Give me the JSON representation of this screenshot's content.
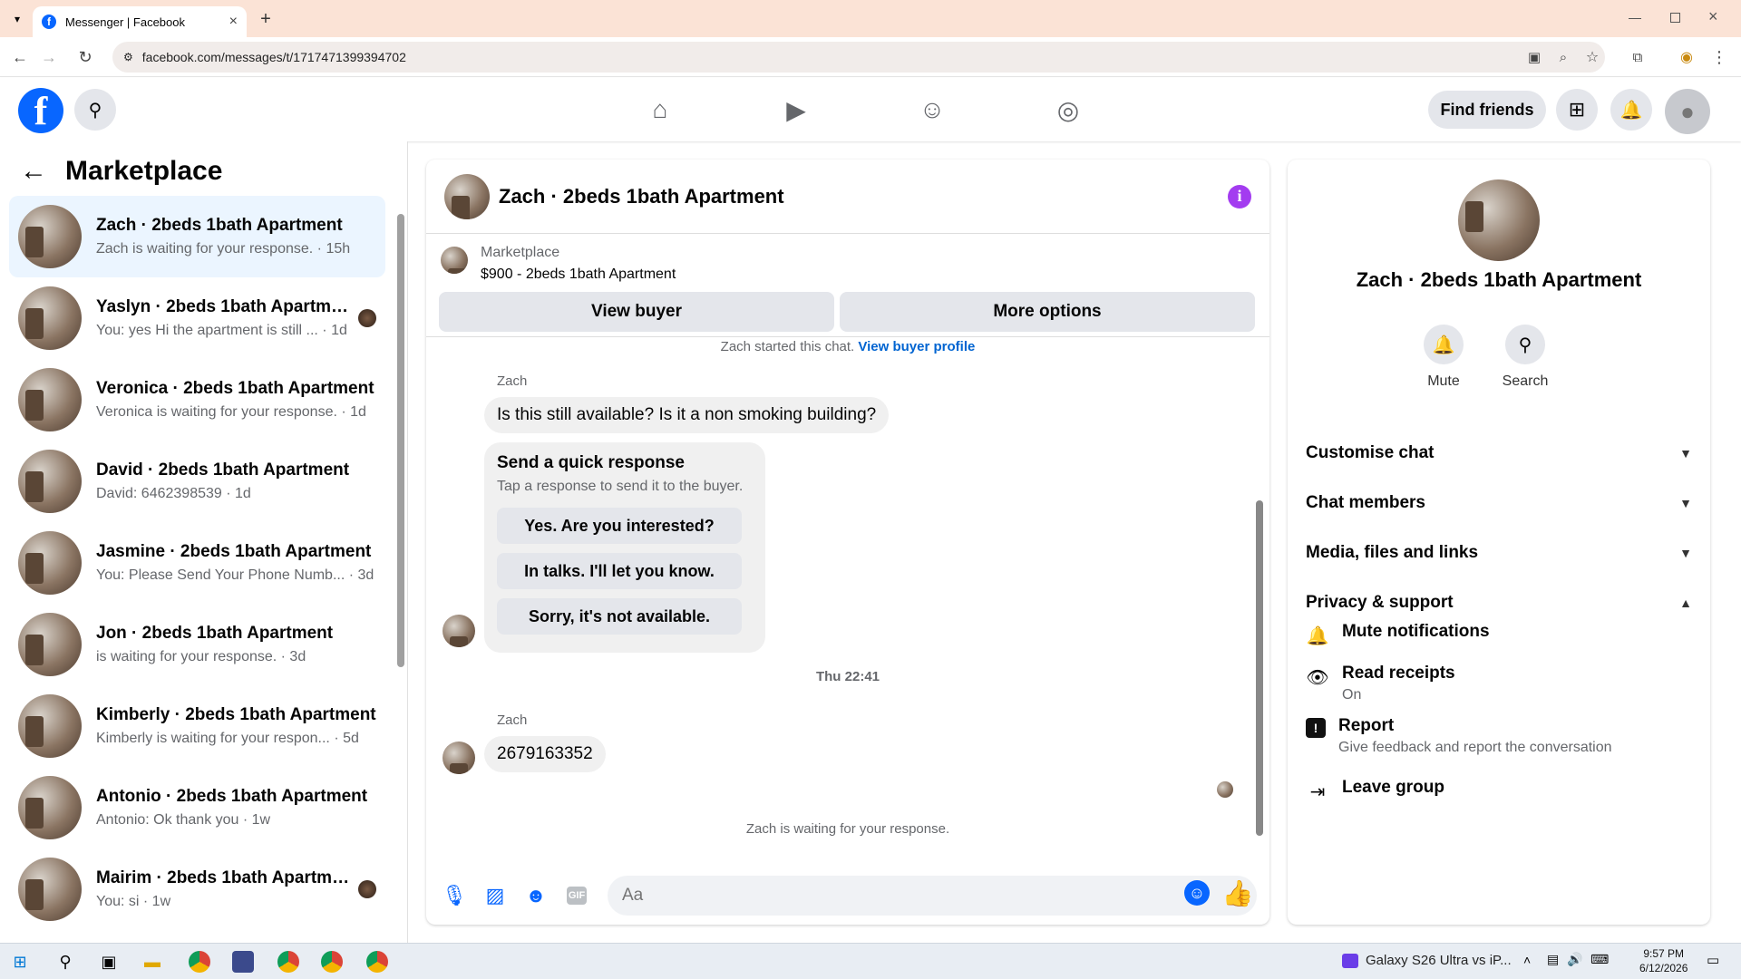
{
  "browser": {
    "tab_title": "Messenger | Facebook",
    "favicon_text": "f",
    "new_tab": "+",
    "close_tab": "×",
    "url": "facebook.com/messages/t/1717471399394702"
  },
  "header": {
    "logo": "f",
    "find_friends": "Find friends"
  },
  "left": {
    "title": "Marketplace",
    "conversations": [
      {
        "name": "Zach · 2beds 1bath Apartment",
        "snippet": "Zach is waiting for your response. · 15h",
        "active": true
      },
      {
        "name": "Yaslyn · 2beds 1bath Apartment",
        "snippet": "You: yes Hi the apartment is still ...  · 1d"
      },
      {
        "name": "Veronica · 2beds 1bath Apartment",
        "snippet": "Veronica is waiting for your response. · 1d"
      },
      {
        "name": "David · 2beds 1bath Apartment",
        "snippet": "David: 6462398539 · 1d"
      },
      {
        "name": "Jasmine · 2beds 1bath Apartment",
        "snippet": "You: Please Send Your Phone Numb... · 3d"
      },
      {
        "name": "Jon · 2beds 1bath Apartment",
        "snippet": "is waiting for your response. · 3d"
      },
      {
        "name": "Kimberly · 2beds 1bath Apartment",
        "snippet": "Kimberly is waiting for your respon...  · 5d"
      },
      {
        "name": "Antonio · 2beds 1bath Apartment",
        "snippet": "Antonio: Ok thank you · 1w"
      },
      {
        "name": "Mairim · 2beds 1bath Apartment",
        "snippet": "You: si · 1w"
      }
    ]
  },
  "chat": {
    "title": "Zach · 2beds 1bath Apartment",
    "info_icon": "i",
    "marketplace_label": "Marketplace",
    "listing": "$900 - 2beds 1bath Apartment",
    "view_buyer": "View buyer",
    "more_options": "More options",
    "started_prefix": "Zach started this chat.",
    "view_buyer_profile": "View buyer profile",
    "sender1": "Zach",
    "message1": "Is this still available? Is it a non smoking building?",
    "quick_title": "Send a quick response",
    "quick_sub": "Tap a response to send it to the buyer.",
    "quick_options": [
      "Yes. Are you interested?",
      "In talks. I'll let you know.",
      "Sorry, it's not available."
    ],
    "timestamp": "Thu 22:41",
    "sender2": "Zach",
    "message2": "2679163352",
    "waiting": "Zach is waiting for your response.",
    "input_placeholder": "Aa",
    "gif_label": "GIF"
  },
  "right": {
    "name": "Zach · 2beds 1bath Apartment",
    "mute": "Mute",
    "search": "Search",
    "sections": [
      "Customise chat",
      "Chat members",
      "Media, files and links",
      "Privacy & support"
    ],
    "mute_notifications": "Mute notifications",
    "read_receipts": "Read receipts",
    "read_receipts_state": "On",
    "report": "Report",
    "report_sub": "Give feedback and report the conversation",
    "leave_group": "Leave group"
  },
  "taskbar": {
    "media_title": "Galaxy S26 Ultra vs iP...",
    "time": "9:57 PM",
    "date": "6/12/2026"
  },
  "colors": {
    "brand": "#0866ff",
    "info": "#a33cf0"
  }
}
